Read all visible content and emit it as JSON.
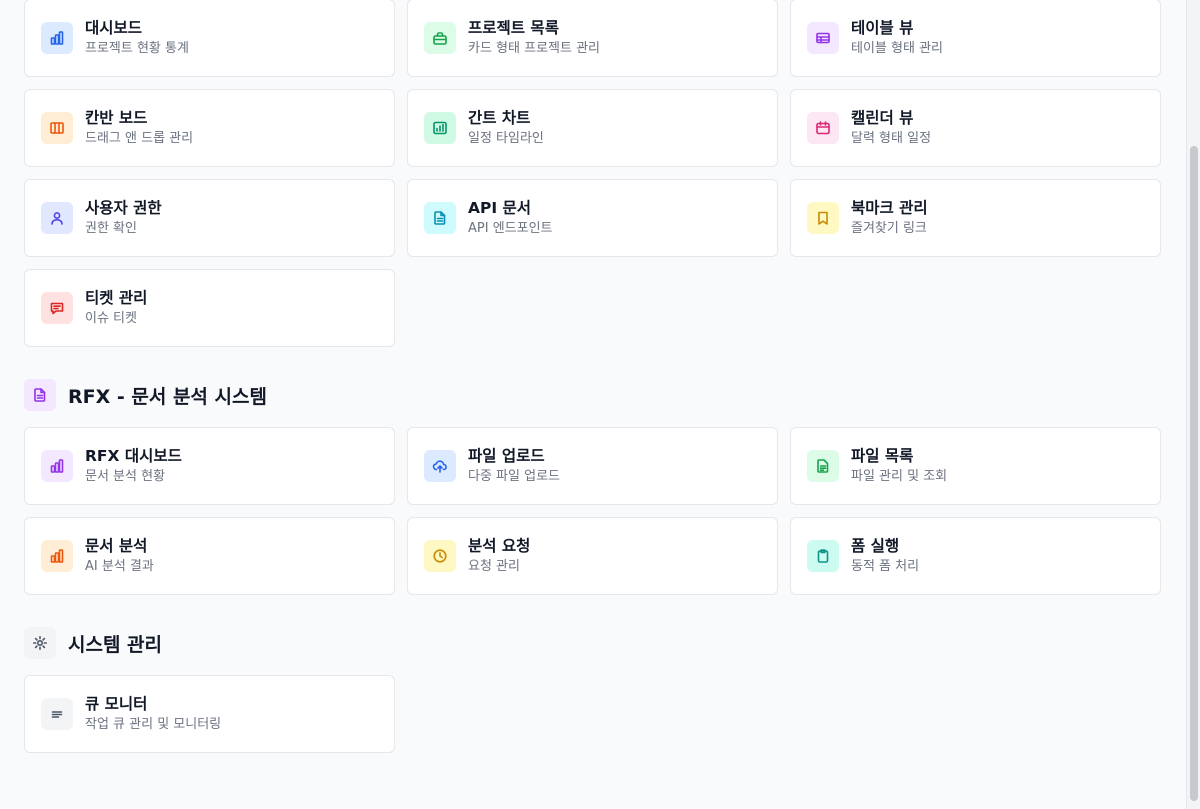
{
  "groups": [
    {
      "cards": [
        {
          "title": "대시보드",
          "subtitle": "프로젝트 현황 통계",
          "icon": "bar-chart-icon",
          "bg": "#dbeafe",
          "fg": "#2563eb"
        },
        {
          "title": "프로젝트 목록",
          "subtitle": "카드 형태 프로젝트 관리",
          "icon": "briefcase-icon",
          "bg": "#dcfce7",
          "fg": "#16a34a"
        },
        {
          "title": "테이블 뷰",
          "subtitle": "테이블 형태 관리",
          "icon": "table-icon",
          "bg": "#f3e8ff",
          "fg": "#9333ea"
        },
        {
          "title": "칸반 보드",
          "subtitle": "드래그 앤 드롭 관리",
          "icon": "kanban-icon",
          "bg": "#ffedd5",
          "fg": "#ea580c"
        },
        {
          "title": "간트 차트",
          "subtitle": "일정 타임라인",
          "icon": "gantt-chart-icon",
          "bg": "#d1fae5",
          "fg": "#059669"
        },
        {
          "title": "캘린더 뷰",
          "subtitle": "달력 형태 일정",
          "icon": "calendar-icon",
          "bg": "#fce7f3",
          "fg": "#db2777"
        },
        {
          "title": "사용자 권한",
          "subtitle": "권한 확인",
          "icon": "user-icon",
          "bg": "#e0e7ff",
          "fg": "#4f46e5"
        },
        {
          "title": "API 문서",
          "subtitle": "API 엔드포인트",
          "icon": "document-icon",
          "bg": "#cffafe",
          "fg": "#0891b2"
        },
        {
          "title": "북마크 관리",
          "subtitle": "즐겨찾기 링크",
          "icon": "bookmark-icon",
          "bg": "#fef9c3",
          "fg": "#ca8a04"
        },
        {
          "title": "티켓 관리",
          "subtitle": "이슈 티켓",
          "icon": "message-icon",
          "bg": "#fee2e2",
          "fg": "#dc2626"
        }
      ]
    },
    {
      "title": "RFX - 문서 분석 시스템",
      "icon": "document-icon",
      "bg": "#f3e8ff",
      "fg": "#9333ea",
      "cards": [
        {
          "title": "RFX 대시보드",
          "subtitle": "문서 분석 현황",
          "icon": "bar-chart-icon",
          "bg": "#f3e8ff",
          "fg": "#9333ea"
        },
        {
          "title": "파일 업로드",
          "subtitle": "다중 파일 업로드",
          "icon": "cloud-upload-icon",
          "bg": "#dbeafe",
          "fg": "#2563eb"
        },
        {
          "title": "파일 목록",
          "subtitle": "파일 관리 및 조회",
          "icon": "file-list-icon",
          "bg": "#dcfce7",
          "fg": "#16a34a"
        },
        {
          "title": "문서 분석",
          "subtitle": "AI 분석 결과",
          "icon": "bar-chart-icon",
          "bg": "#ffedd5",
          "fg": "#ea580c"
        },
        {
          "title": "분석 요청",
          "subtitle": "요청 관리",
          "icon": "clock-icon",
          "bg": "#fef9c3",
          "fg": "#ca8a04"
        },
        {
          "title": "폼 실행",
          "subtitle": "동적 폼 처리",
          "icon": "clipboard-icon",
          "bg": "#ccfbf1",
          "fg": "#0d9488"
        }
      ]
    },
    {
      "title": "시스템 관리",
      "icon": "gear-icon",
      "bg": "#f3f4f6",
      "fg": "#4b5563",
      "cards": [
        {
          "title": "큐 모니터",
          "subtitle": "작업 큐 관리 및 모니터링",
          "icon": "queue-icon",
          "bg": "#f3f4f6",
          "fg": "#4b5563"
        }
      ]
    }
  ]
}
